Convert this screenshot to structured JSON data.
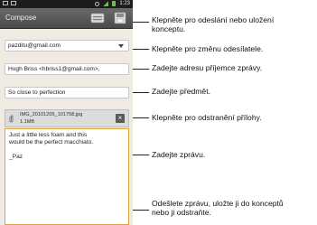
{
  "status_bar": {
    "time": "1:23"
  },
  "app": {
    "title": "Compose"
  },
  "toolbar": {
    "send_icon": "send-icon",
    "save_icon": "save-draft-icon"
  },
  "compose": {
    "from": "pazditu@gmail.com",
    "to": "Hugh Briss <hbriss1@gmail.com>,",
    "subject": "So close to perfection",
    "attachment": {
      "name": "IMG_20101205_101758.jpg",
      "size": "1.1MB",
      "remove_label": "×"
    },
    "body": {
      "line1": "Just a little less foam and this",
      "line2": "would be the perfect macchiato.",
      "signature": "_Paz"
    }
  },
  "callouts": {
    "send_save": {
      "line1": "Klepněte pro odeslání nebo uložení",
      "line2": "konceptu."
    },
    "sender": "Klepněte pro změnu odesílatele.",
    "recipient": "Zadejte adresu příjemce zprávy.",
    "subject": "Zadejte předmět.",
    "remove_attachment": "Klepněte pro odstranění přílohy.",
    "message": "Zadejte zprávu.",
    "actions": {
      "line1": "Odešlete zprávu, uložte ji do konceptů",
      "line2": "nebo ji odstraňte."
    }
  }
}
